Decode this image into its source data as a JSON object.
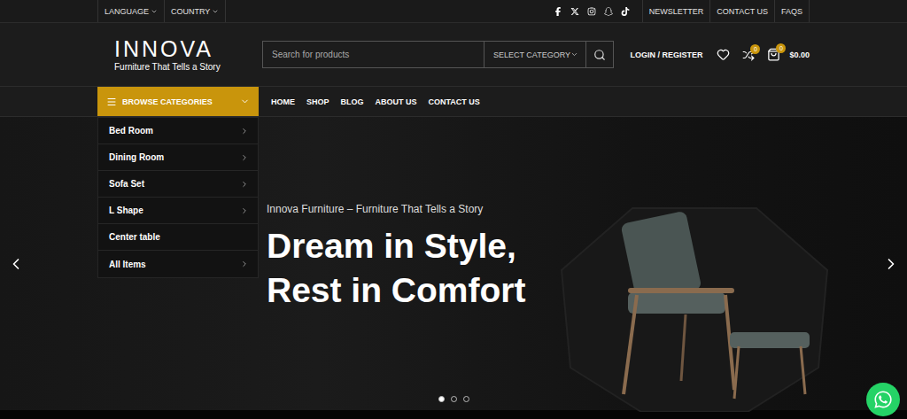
{
  "top_bar": {
    "selectors": [
      {
        "label": "LANGUAGE"
      },
      {
        "label": "COUNTRY"
      }
    ],
    "links": [
      {
        "label": "NEWSLETTER"
      },
      {
        "label": "CONTACT US"
      },
      {
        "label": "FAQS"
      }
    ]
  },
  "logo": {
    "name": "INNOVA",
    "tagline": "Furniture That Tells a Story"
  },
  "search": {
    "placeholder": "Search for products",
    "category": "SELECT CATEGORY"
  },
  "account": {
    "login": "LOGIN / REGISTER",
    "compare_count": "0",
    "cart_count": "0",
    "cart_total": "$0.00"
  },
  "nav": {
    "browse": "BROWSE CATEGORIES",
    "items": [
      {
        "label": "HOME"
      },
      {
        "label": "SHOP"
      },
      {
        "label": "BLOG"
      },
      {
        "label": "ABOUT US"
      },
      {
        "label": "CONTACT US"
      }
    ]
  },
  "categories": [
    {
      "label": "Bed Room",
      "has_submenu": true
    },
    {
      "label": "Dining Room",
      "has_submenu": true
    },
    {
      "label": "Sofa Set",
      "has_submenu": true
    },
    {
      "label": "L Shape",
      "has_submenu": true
    },
    {
      "label": "Center table",
      "has_submenu": false
    },
    {
      "label": "All Items",
      "has_submenu": true
    }
  ],
  "hero": {
    "subtitle": "Innova Furniture – Furniture That Tells a Story",
    "title_lines": [
      "Dream in Style,",
      "Rest in Comfort"
    ]
  },
  "slider": {
    "slides": [
      {
        "selected": true
      },
      {
        "selected": false
      },
      {
        "selected": false
      }
    ]
  }
}
